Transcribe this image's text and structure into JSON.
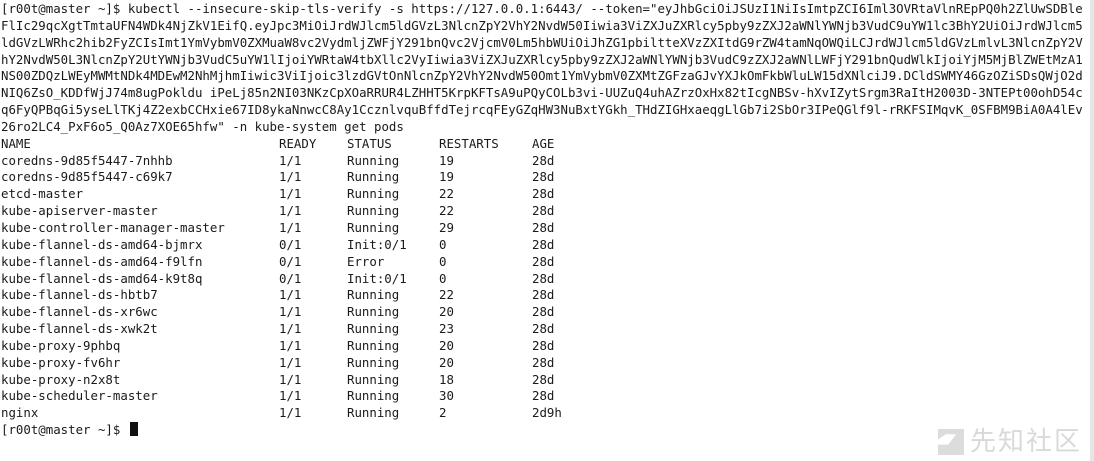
{
  "session": {
    "command_line": "[r00t@master ~]$ kubectl --insecure-skip-tls-verify -s https://127.0.0.1:6443/ --token=\"eyJhbGciOiJSUzI1NiIsImtpZCI6Iml3OVRtaVlnREpPQ0h2ZlUwSDBleFlIc29qcXgtTmtaUFN4WDk4NjZkV1EifQ.eyJpc3MiOiJrdWJlcm5ldGVzL3NlcnZpY2VhY2NvdW50Iiwia3ViZXJuZXRlcy5pby9zZXJ2aWNlYWNjb3VudC9uYW1lc3BhY2UiOiJrdWJlcm5ldGVzLWRhc2hib2FyZCIsImt1YmVybmV0ZXMuaW8vc2VydmljZWFjY291bnQvc2VjcmV0Lm5hbWUiOiJhZG1pbiltteXVzZXItdG9rZW4tamNqOWQiLCJrdWJlcm5ldGVzLmlvL3NlcnZpY2VhY2NvdW50L3NlcnZpY2UtYWNjb3VudC5uYW1lIjoiYWRtaW4tbXllc2VyIiwia3ViZXJuZXRlcy5pby9zZXJ2aWNlYWNjb3VudC9zZXJ2aWNlLWFjY291bnQudWlkIjoiYjM5MjBlZWEtMzA1NS00ZDQzLWEyMWMtNDk4MDEwM2NhMjhmIiwic3ViIjoic3lzdGVtOnNlcnZpY2VhY2NvdW50Omt1YmVybmV0ZXMtZGFzaGJvYXJkOmFkbWluLW15dXNlciJ9.DCldSWMY46GzOZiSDsQWjO2dNIQ6ZsO_KDDfWjJ74m8ugPokldu iPeLj85n2NI03NKzCpXOaRRUR4LZHHT5KrpKFTsA9uPQyCOLb3vi-UUZuQ4uhAZrzOxHx82tIcgNBSv-hXvIZytSrgm3RaItH2003D-3NTEPt00ohD54cq6FyQPBqGi5yseLlTKj4Z2exbCCHxie67ID8ykaNnwcC8Ay1CcznlvquBffdTejrcqFEyGZqHW3NuBxtYGkh_THdZIGHxaeqgLlGb7i2SbOr3IPeQGlf9l-rRKFSIMqvK_0SFBM9BiA0A4lEv26ro2LC4_PxF6o5_Q0Az7XOE65hfw\" -n kube-system get pods",
    "prompt_end": "[r00t@master ~]$ "
  },
  "table": {
    "headers": {
      "name": "NAME",
      "ready": "READY",
      "status": "STATUS",
      "restarts": "RESTARTS",
      "age": "AGE"
    },
    "rows": [
      {
        "name": "coredns-9d85f5447-7nhhb",
        "ready": "1/1",
        "status": "Running",
        "restarts": "19",
        "age": "28d"
      },
      {
        "name": "coredns-9d85f5447-c69k7",
        "ready": "1/1",
        "status": "Running",
        "restarts": "19",
        "age": "28d"
      },
      {
        "name": "etcd-master",
        "ready": "1/1",
        "status": "Running",
        "restarts": "22",
        "age": "28d"
      },
      {
        "name": "kube-apiserver-master",
        "ready": "1/1",
        "status": "Running",
        "restarts": "22",
        "age": "28d"
      },
      {
        "name": "kube-controller-manager-master",
        "ready": "1/1",
        "status": "Running",
        "restarts": "29",
        "age": "28d"
      },
      {
        "name": "kube-flannel-ds-amd64-bjmrx",
        "ready": "0/1",
        "status": "Init:0/1",
        "restarts": "0",
        "age": "28d"
      },
      {
        "name": "kube-flannel-ds-amd64-f9lfn",
        "ready": "0/1",
        "status": "Error",
        "restarts": "0",
        "age": "28d"
      },
      {
        "name": "kube-flannel-ds-amd64-k9t8q",
        "ready": "0/1",
        "status": "Init:0/1",
        "restarts": "0",
        "age": "28d"
      },
      {
        "name": "kube-flannel-ds-hbtb7",
        "ready": "1/1",
        "status": "Running",
        "restarts": "22",
        "age": "28d"
      },
      {
        "name": "kube-flannel-ds-xr6wc",
        "ready": "1/1",
        "status": "Running",
        "restarts": "20",
        "age": "28d"
      },
      {
        "name": "kube-flannel-ds-xwk2t",
        "ready": "1/1",
        "status": "Running",
        "restarts": "23",
        "age": "28d"
      },
      {
        "name": "kube-proxy-9phbq",
        "ready": "1/1",
        "status": "Running",
        "restarts": "20",
        "age": "28d"
      },
      {
        "name": "kube-proxy-fv6hr",
        "ready": "1/1",
        "status": "Running",
        "restarts": "20",
        "age": "28d"
      },
      {
        "name": "kube-proxy-n2x8t",
        "ready": "1/1",
        "status": "Running",
        "restarts": "18",
        "age": "28d"
      },
      {
        "name": "kube-scheduler-master",
        "ready": "1/1",
        "status": "Running",
        "restarts": "30",
        "age": "28d"
      },
      {
        "name": "nginx",
        "ready": "1/1",
        "status": "Running",
        "restarts": "2",
        "age": "2d9h"
      }
    ]
  },
  "watermark": {
    "text": "先知社区",
    "icon": "xianzhi-logo-icon"
  },
  "colors": {
    "background": "#ffffff",
    "foreground": "#1a1a1a",
    "watermark": "#d9d9d9"
  }
}
